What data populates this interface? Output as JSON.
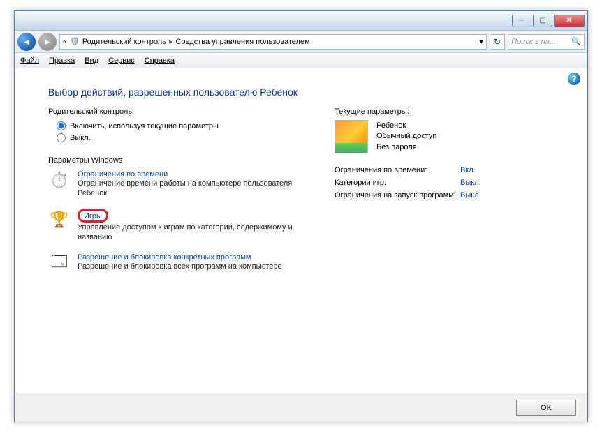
{
  "breadcrumb": {
    "item1": "Родительский контроль",
    "item2": "Средства управления пользователем"
  },
  "search": {
    "placeholder": "Поиск в па..."
  },
  "menu": {
    "file": "Файл",
    "edit": "Правка",
    "view": "Вид",
    "service": "Сервис",
    "help": "Справка"
  },
  "page": {
    "title": "Выбор действий, разрешенных пользователю Ребенок"
  },
  "pc": {
    "label": "Родительский контроль:",
    "opt_on": "Включить, используя текущие параметры",
    "opt_off": "Выкл."
  },
  "winparams": {
    "label": "Параметры Windows",
    "time": {
      "title": "Ограничения по времени",
      "desc": "Ограничение времени работы на компьютере пользователя Ребенок"
    },
    "games": {
      "title": "Игры",
      "desc": "Управление доступом к играм по категории, содержимому и названию"
    },
    "programs": {
      "title": "Разрешение и блокировка конкретных программ",
      "desc": "Разрешение и блокировка всех программ на компьютере"
    }
  },
  "current": {
    "label": "Текущие параметры:",
    "user": {
      "name": "Ребенок",
      "role": "Обычный доступ",
      "password": "Без пароля"
    },
    "rows": {
      "time_label": "Ограничения по времени:",
      "time_val": "Вкл.",
      "games_label": "Категории игр:",
      "games_val": "Выкл.",
      "prog_label": "Ограничения на запуск программ:",
      "prog_val": "Выкл."
    }
  },
  "buttons": {
    "ok": "OK"
  }
}
